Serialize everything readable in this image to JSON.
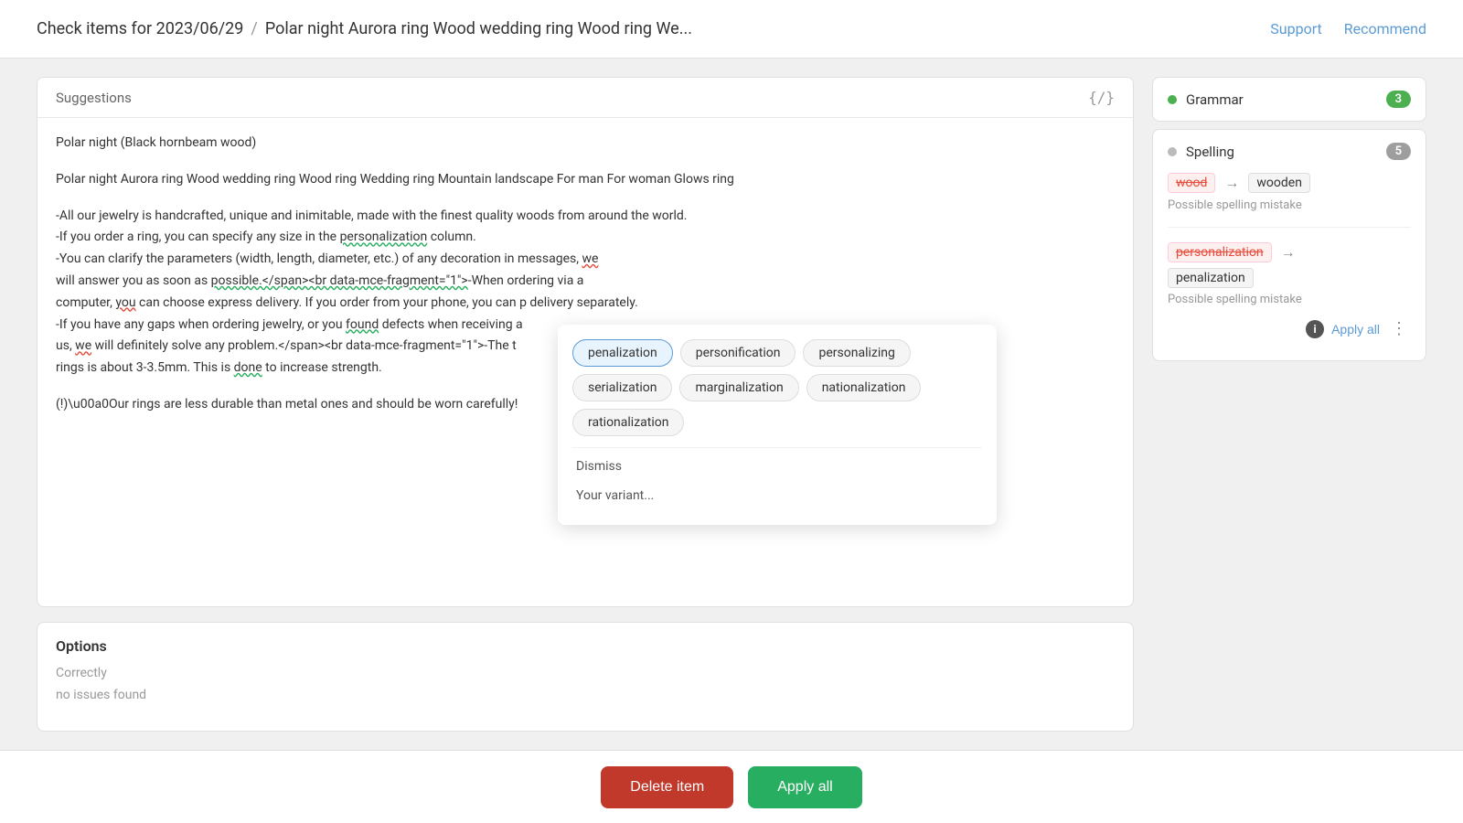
{
  "header": {
    "breadcrumb_base": "Check items for 2023/06/29",
    "breadcrumb_separator": "/",
    "breadcrumb_title": "Polar night Aurora ring Wood wedding ring Wood ring We...",
    "support_label": "Support",
    "recommend_label": "Recommend"
  },
  "suggestions": {
    "label": "Suggestions",
    "code_icon": "{/}",
    "text_blocks": [
      "Polar night (Black hornbeam wood)",
      "Polar night Aurora ring Wood wedding ring Wood ring Wedding ring Mountain landscape For man For woman Glows ring",
      "-All our jewelry is handcrafted, unique and inimitable, made with the finest quality woods from around the world.\n-If you order a ring, you can specify any size in the personalization column.\n-You can clarify the parameters (width, length, diameter, etc.) of any decoration in messages, we will answer you as soon as possible.</span><br data-mce-fragment=\"1\">-When ordering via a computer, you can choose express delivery. If you order from your phone, you can p delivery separately.\n-If you have any gaps when ordering jewelry, or you found defects when receiving a us, we will definitely solve any problem.</span><br data-mce-fragment=\"1\">-The t rings is about 3-3.5mm. This is done to increase strength.",
      "(!) Our rings are less durable than metal ones and should be worn carefully!"
    ]
  },
  "options": {
    "title": "Options",
    "label": "Correctly",
    "value": "no issues found"
  },
  "right_panel": {
    "grammar": {
      "label": "Grammar",
      "count": 3,
      "dot_color": "green"
    },
    "spelling": {
      "label": "Spelling",
      "count": 5,
      "dot_color": "gray"
    },
    "correction1": {
      "original": "wood",
      "arrow": "→",
      "replacement": "wooden",
      "description": "Possible spelling mistake"
    },
    "correction2": {
      "original": "personalization",
      "arrow": "→",
      "replacement": "penalization",
      "description": "Possible spelling mistake",
      "apply_all_label": "Apply all"
    }
  },
  "dropdown": {
    "chips": [
      "penalization",
      "personification",
      "personalizing",
      "serialization",
      "marginalization",
      "nationalization",
      "rationalization"
    ],
    "dismiss_label": "Dismiss",
    "your_variant_label": "Your variant..."
  },
  "bottom_bar": {
    "delete_label": "Delete item",
    "apply_all_label": "Apply all"
  }
}
